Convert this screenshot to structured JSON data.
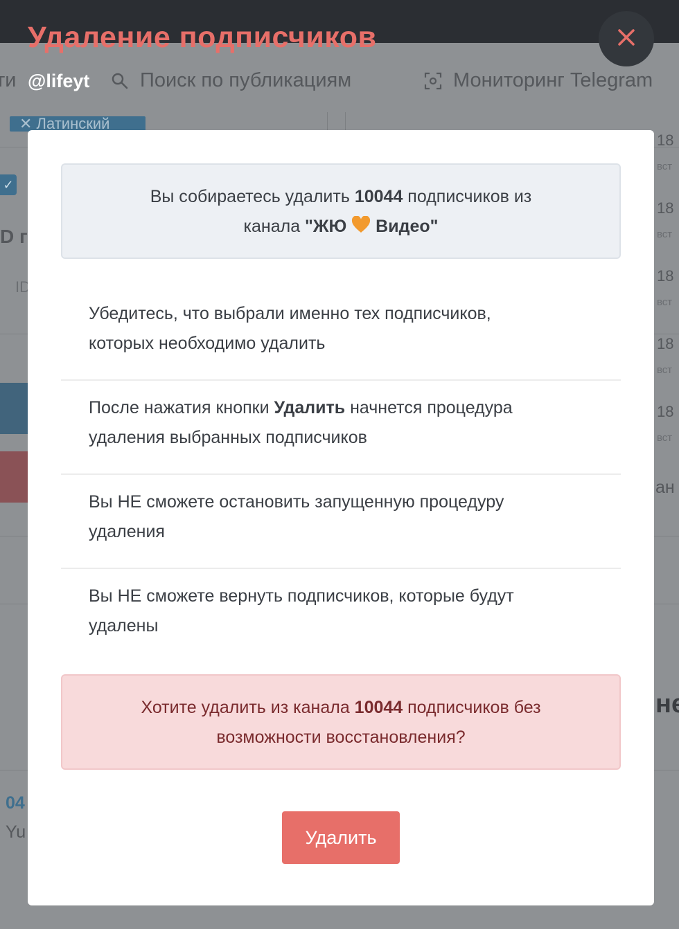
{
  "background": {
    "nav": {
      "left_fragment": "ти",
      "search_label": "Поиск по публикациям",
      "monitor_label": "Мониторинг Telegram"
    },
    "chip_label": "✕ Латинский",
    "fragments": {
      "id_bold": "D г",
      "id_small": "ID",
      "num_left": "04",
      "name_left": "Yu",
      "right_word": "ан",
      "right_heading": "не"
    },
    "side_numbers": [
      "18",
      "18",
      "18",
      "18",
      "18"
    ],
    "side_sub": [
      "вст",
      "вст",
      "вст",
      "вст",
      "вст"
    ]
  },
  "modal": {
    "title": "Удаление подписчиков",
    "subtitle": "@lifeyt",
    "info": {
      "prefix": "Вы собираетесь удалить ",
      "count": "10044",
      "middle": " подписчиков из",
      "line2_prefix": "канала ",
      "channel_open": "\"ЖЮ ",
      "channel_close": " Видео\""
    },
    "notes": [
      {
        "text_before": "Убедитесь, что выбрали именно тех подписчиков,",
        "bold": "",
        "text_after": "которых необходимо удалить"
      },
      {
        "text_before": "После нажатия кнопки ",
        "bold": "Удалить",
        "text_after": " начнется процедура удаления выбранных подписчиков"
      },
      {
        "text_before": "Вы НЕ сможете остановить запущенную процедуру",
        "bold": "",
        "text_after": "удаления"
      },
      {
        "text_before": "Вы НЕ сможете вернуть подписчиков, которые будут",
        "bold": "",
        "text_after": "удалены"
      }
    ],
    "warning": {
      "prefix": "Хотите удалить из канала ",
      "count": "10044",
      "suffix": " подписчиков без",
      "line2": "возможности восстановления?"
    },
    "delete_label": "Удалить"
  },
  "colors": {
    "accent": "#e76f69",
    "warning_bg": "#f8dadb",
    "info_bg": "#edf0f4",
    "overlay_topbar": "#2b2e33"
  }
}
